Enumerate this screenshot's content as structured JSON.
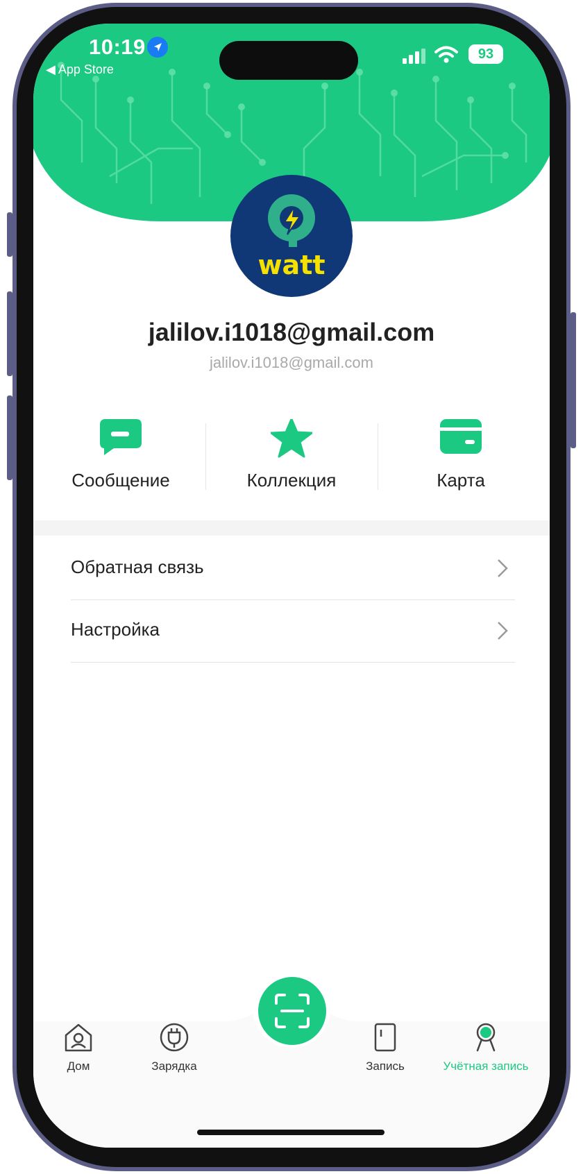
{
  "status_bar": {
    "time": "10:19",
    "back_label": "◀ App Store",
    "battery": "93"
  },
  "profile": {
    "logo_text": "watt",
    "name": "jalilov.i1018@gmail.com",
    "email": "jalilov.i1018@gmail.com"
  },
  "quick_actions": [
    {
      "label": "Сообщение",
      "icon": "message-icon"
    },
    {
      "label": "Коллекция",
      "icon": "star-icon"
    },
    {
      "label": "Карта",
      "icon": "card-icon"
    }
  ],
  "menu": [
    {
      "label": "Обратная связь"
    },
    {
      "label": "Настройка"
    }
  ],
  "tabbar": {
    "items": [
      {
        "label": "Дом",
        "icon": "home-icon"
      },
      {
        "label": "Зарядка",
        "icon": "plug-icon"
      },
      {
        "label": "Запись",
        "icon": "record-icon"
      },
      {
        "label": "Учётная запись",
        "icon": "account-icon"
      }
    ],
    "active_index": 3,
    "scan_icon": "scan-icon"
  },
  "colors": {
    "accent": "#1CC983",
    "avatar_bg": "#103876",
    "logo_yellow": "#F5E100"
  }
}
